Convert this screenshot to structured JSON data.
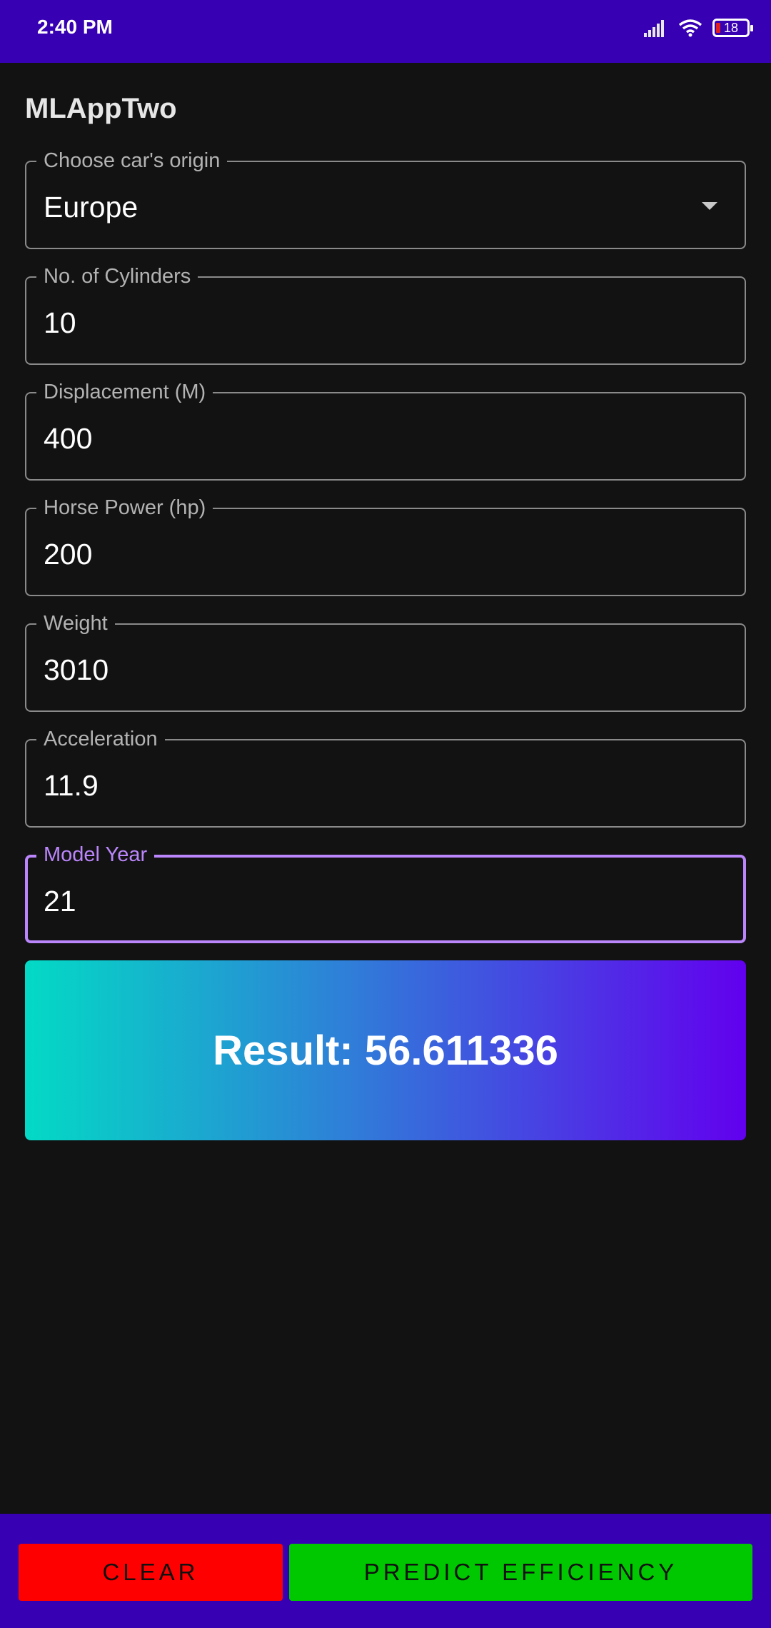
{
  "status_bar": {
    "time": "2:40 PM",
    "battery_level": "18",
    "icons": [
      "signal-icon",
      "wifi-icon",
      "battery-icon"
    ]
  },
  "app": {
    "title": "MLAppTwo"
  },
  "form": {
    "origin": {
      "label": "Choose car's origin",
      "value": "Europe"
    },
    "cylinders": {
      "label": "No. of Cylinders",
      "value": "10"
    },
    "displacement": {
      "label": "Displacement (M)",
      "value": "400"
    },
    "horsepower": {
      "label": "Horse Power (hp)",
      "value": "200"
    },
    "weight": {
      "label": "Weight",
      "value": "3010"
    },
    "acceleration": {
      "label": "Acceleration",
      "value": "11.9"
    },
    "model_year": {
      "label": "Model Year",
      "value": "21"
    }
  },
  "result": {
    "text": "Result: 56.611336"
  },
  "actions": {
    "clear_label": "CLEAR",
    "predict_label": "PREDICT EFFICIENCY"
  },
  "colors": {
    "status_bar": "#3700B3",
    "focused_accent": "#BB86FC",
    "gradient_start": "#03DAC5",
    "gradient_end": "#6200EE",
    "clear_button": "#FF0000",
    "predict_button": "#00C800"
  }
}
